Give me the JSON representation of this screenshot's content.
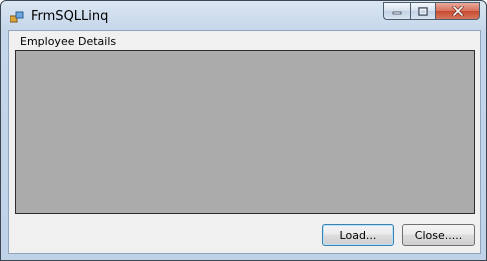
{
  "window": {
    "title": "FrmSQLLinq"
  },
  "group": {
    "label": "Employee Details"
  },
  "buttons": {
    "load": "Load...",
    "close": "Close....."
  }
}
